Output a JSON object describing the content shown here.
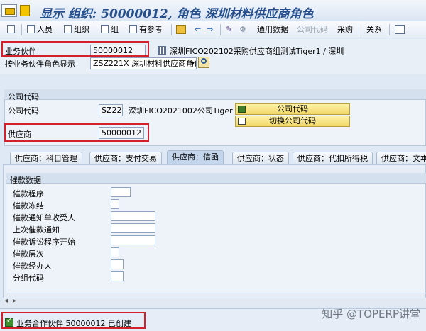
{
  "window": {
    "title": "显示 组织: 50000012, 角色 深圳材料供应商角色"
  },
  "toolbar": {
    "items": [
      "人员",
      "组织",
      "组",
      "有参考"
    ],
    "general_data": "通用数据",
    "company_code": "公司代码",
    "purchasing": "采购",
    "relationships": "关系"
  },
  "header": {
    "bp_label": "业务伙伴",
    "bp_value": "50000012",
    "bp_description": "深圳FICO202102采购供应商组测试Tiger1 / 深圳",
    "role_label": "按业务伙伴角色显示",
    "role_value": "ZSZ221X 深圳材料供应商角色"
  },
  "company_code_panel": {
    "section_title": "公司代码",
    "cc_label": "公司代码",
    "cc_value": "SZ22",
    "cc_description": "深圳FICO2021002公司Tiger",
    "cc_button": "公司代码",
    "switch_button": "切换公司代码",
    "vendor_label": "供应商",
    "vendor_value": "50000012"
  },
  "tabs": [
    {
      "label": "供应商：科目管理",
      "active": false
    },
    {
      "label": "供应商：支付交易",
      "active": false
    },
    {
      "label": "供应商：信函",
      "active": true
    },
    {
      "label": "供应商：状态",
      "active": false
    },
    {
      "label": "供应商：代扣所得税",
      "active": false
    },
    {
      "label": "供应商：文本",
      "active": false
    }
  ],
  "dunning": {
    "section_title": "催款数据",
    "fields": [
      "催款程序",
      "催款冻结",
      "催款通知单收受人",
      "上次催款通知",
      "催款诉讼程序开始",
      "催款层次",
      "催款经办人",
      "分组代码"
    ]
  },
  "status": {
    "message": "业务合作伙伴 50000012 已创建"
  },
  "watermark": "知乎 @TOPERP讲堂"
}
